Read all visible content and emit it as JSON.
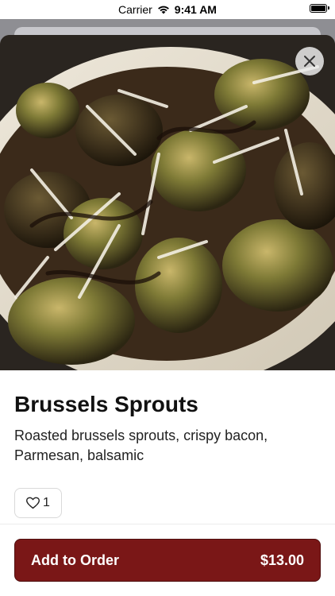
{
  "status_bar": {
    "carrier": "Carrier",
    "time": "9:41 AM",
    "battery_level": 1.0
  },
  "item": {
    "title": "Brussels Sprouts",
    "description": "Roasted brussels sprouts, crispy bacon, Parmesan, balsamic",
    "image_alt": "Roasted brussels sprouts with parmesan and balsamic",
    "like_count": "1"
  },
  "actions": {
    "close_icon": "close-icon",
    "like_icon": "heart-icon",
    "add_to_order_label": "Add to Order",
    "price": "$13.00"
  },
  "colors": {
    "accent": "#7a1717",
    "accent_border": "#4f0e0e"
  }
}
